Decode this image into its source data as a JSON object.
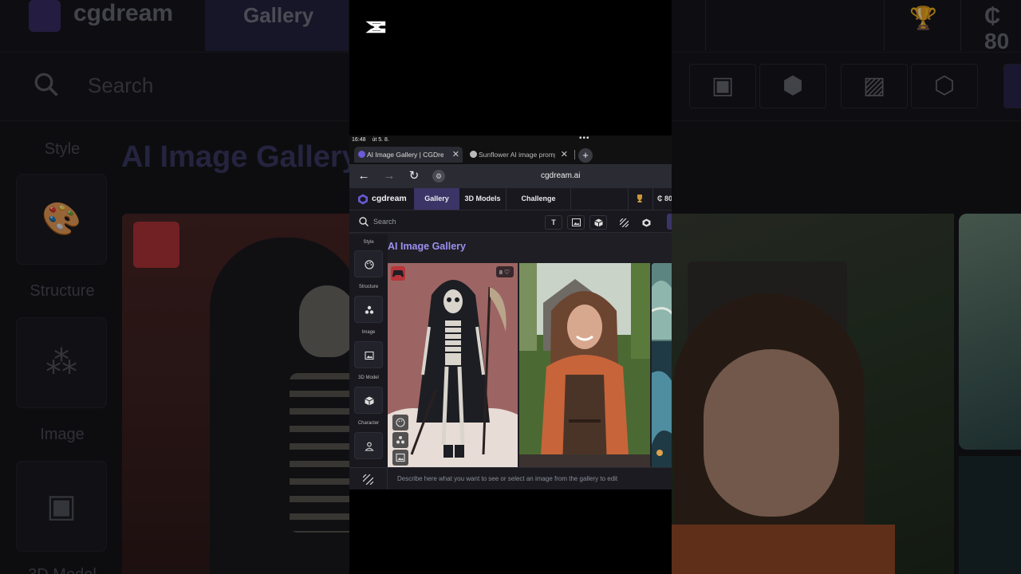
{
  "background": {
    "brand": "cgdream",
    "nav_gallery": "Gallery",
    "credits": "₵ 80",
    "search_placeholder": "Search",
    "sidebar": [
      "Style",
      "Structure",
      "Image",
      "3D Model"
    ],
    "page_title": "AI Image Gallery"
  },
  "status_bar": {
    "time": "16:48",
    "date": "út 5. 8."
  },
  "tabs": [
    {
      "label": "AI Image Gallery | CGDream",
      "active": true
    },
    {
      "label": "Sunflower AI image prompt",
      "active": false
    }
  ],
  "url": "cgdream.ai",
  "site": {
    "brand": "cgdream",
    "nav": [
      "Gallery",
      "3D Models",
      "Challenge"
    ],
    "credits": "₵ 80",
    "accent": "#3b3466",
    "title_color": "#9c8ff0"
  },
  "search": {
    "placeholder": "Search",
    "tools": [
      "T",
      "image-icon",
      "cube-icon",
      "stripes-icon",
      "cgdream-icon"
    ]
  },
  "sidebar": {
    "sections": [
      {
        "label": "Style",
        "icon": "palette-icon"
      },
      {
        "label": "Structure",
        "icon": "nodes-icon"
      },
      {
        "label": "Image",
        "icon": "image-icon"
      },
      {
        "label": "3D Model",
        "icon": "cube-icon"
      },
      {
        "label": "Character",
        "icon": "person-icon"
      }
    ]
  },
  "gallery": {
    "title": "AI Image Gallery",
    "cards": [
      {
        "subject": "Hooded grim reaper skeleton with scythe",
        "likes": "8"
      },
      {
        "subject": "Smiling woman in overalls on a farm"
      },
      {
        "subject": "Teal fantasy illustration"
      }
    ]
  },
  "prompt_bar": {
    "placeholder": "Describe here what you want to see or select an image from the gallery to edit"
  }
}
